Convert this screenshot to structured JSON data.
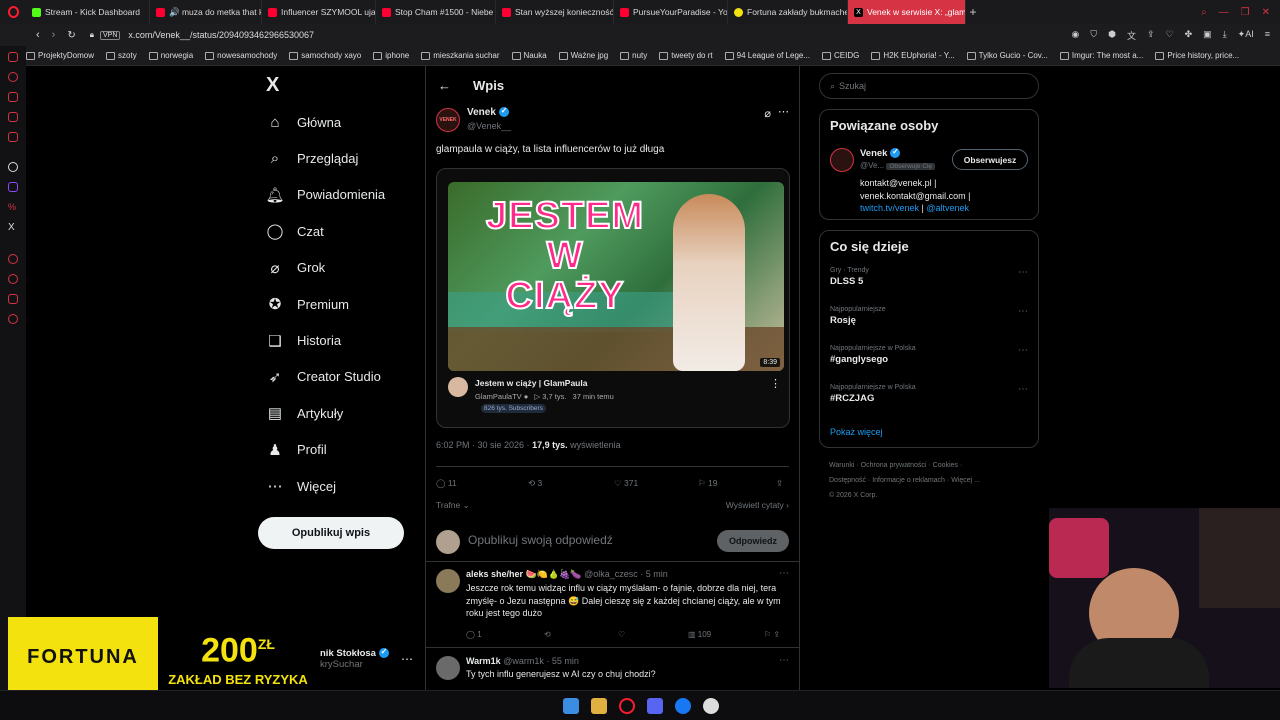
{
  "tabs": [
    {
      "label": "Stream - Kick Dashboard",
      "color": "#53fc18"
    },
    {
      "label": "🔊 muza do metka that ke",
      "color": "#ff0033"
    },
    {
      "label": "Influencer SZYMOOL ujaw",
      "color": "#ff0033"
    },
    {
      "label": "Stop Cham #1500 - Niebe",
      "color": "#ff0033"
    },
    {
      "label": "Stan wyższej konieczność",
      "color": "#ff0033"
    },
    {
      "label": "PursueYourParadise - You",
      "color": "#ff0033"
    },
    {
      "label": "Fortuna zakłady bukmache",
      "color": "#f4e20f"
    },
    {
      "label": "Venek w serwisie X: „glam",
      "color": "#000000"
    }
  ],
  "address": {
    "vpn": "VPN",
    "url": "x.com/Venek__/status/2094093462966530067",
    "ai": "AI"
  },
  "bookmarks": [
    "ProjektyDomow",
    "szoty",
    "norwegia",
    "nowesamochody",
    "samochody xayo",
    "iphone",
    "mieszkania suchar",
    "Nauka",
    "Ważne jpg",
    "nuty",
    "tweety do rt",
    "94 League of Lege...",
    "CEIDG",
    "H2K EUphoria! - Y...",
    "Tylko Gucio - Cov...",
    "Imgur: The most a...",
    "Price history, price..."
  ],
  "nav": {
    "logo": "X",
    "items": [
      {
        "label": "Główna",
        "icon": "⌂"
      },
      {
        "label": "Przeglądaj",
        "icon": "⌕"
      },
      {
        "label": "Powiadomienia",
        "icon": "🔔︎"
      },
      {
        "label": "Czat",
        "icon": "◯"
      },
      {
        "label": "Grok",
        "icon": "⌀"
      },
      {
        "label": "Premium",
        "icon": "✪"
      },
      {
        "label": "Historia",
        "icon": "❑"
      },
      {
        "label": "Creator Studio",
        "icon": "➶"
      },
      {
        "label": "Artykuły",
        "icon": "▤"
      },
      {
        "label": "Profil",
        "icon": "♟"
      },
      {
        "label": "Więcej",
        "icon": "⋯"
      }
    ],
    "post_button": "Opublikuj wpis",
    "account_name": "nik Stokłosa",
    "account_handle": "krySuchar"
  },
  "main": {
    "header": "Wpis",
    "author": {
      "name": "Venek",
      "handle": "@Venek__",
      "avatar_text": "VENEK"
    },
    "text": "glampaula w ciąży, ta lista influencerów to już długa",
    "video": {
      "thumb_line1": "JESTEM",
      "thumb_line2": "W",
      "thumb_line3": "CIĄŻY",
      "duration": "8:39",
      "title": "Jestem w ciąży | GlamPaula",
      "channel": "GlamPaulaTV",
      "views": "▷ 3,7 tys.",
      "time": "37 min temu",
      "subscribers": "826 tys. Subscribers"
    },
    "meta_time": "6:02 PM · 30 sie 2026 · ",
    "meta_views": "17,9 tys.",
    "meta_views_label": " wyświetlenia",
    "stats": {
      "replies": "11",
      "reposts": "3",
      "likes": "371",
      "bookmarks": "19"
    },
    "sort_label": "Trafne",
    "quotes_label": "Wyświetl cytaty ›",
    "reply_placeholder": "Opublikuj swoją odpowiedź",
    "reply_button": "Odpowiedz",
    "replies": [
      {
        "name": "aleks she/her 🍉🍋🍐🍇🍆",
        "handle": "@olka_czesc · 5 min",
        "text": "Jeszcze rok temu widząc influ w ciąży myślałam- o fajnie, dobrze dla niej, tera zmyślę- o Jezu następna 😅 Dalej cieszę się z każdej chcianej ciąży, ale w tym roku jest tego dużo",
        "replies": "1",
        "views": "109"
      },
      {
        "name": "Warm1k",
        "handle": "@warm1k · 55 min",
        "text": "Ty tych influ generujesz w AI czy o chuj chodzi?"
      }
    ]
  },
  "sidebar": {
    "search_placeholder": "Szukaj",
    "related_title": "Powiązane osoby",
    "related": {
      "name": "Venek",
      "handle": "@Ve...",
      "follows_you": "Obserwuje Cię",
      "button": "Obserwujesz",
      "bio1": "kontakt@venek.pl |",
      "bio2": "venek.kontakt@gmail.com |",
      "link1": "twitch.tv/venek",
      "sep": " | ",
      "link2": "@altvenek"
    },
    "trends_title": "Co się dzieje",
    "trends": [
      {
        "context": "Gry · Trendy",
        "name": "DLSS 5"
      },
      {
        "context": "Najpopularniejsze",
        "name": "Rosję"
      },
      {
        "context": "Najpopularniejsze w Polska",
        "name": "#ganglysego"
      },
      {
        "context": "Najpopularniejsze w Polska",
        "name": "#RCZJAG"
      }
    ],
    "show_more": "Pokaż więcej",
    "footer": [
      "Warunki",
      "Ochrona prywatności",
      "Cookies",
      "Dostępność",
      "Informacje o reklamach",
      "Więcej ...",
      "© 2026 X Corp."
    ]
  },
  "ad": {
    "brand": "FORTUNA",
    "amount": "200",
    "currency": "ZŁ",
    "tagline": "ZAKŁAD BEZ RYZYKA"
  },
  "colors": {
    "accent": "#1d9bf0",
    "browser_accent": "#d63344",
    "ad_yellow": "#f4e20f"
  }
}
